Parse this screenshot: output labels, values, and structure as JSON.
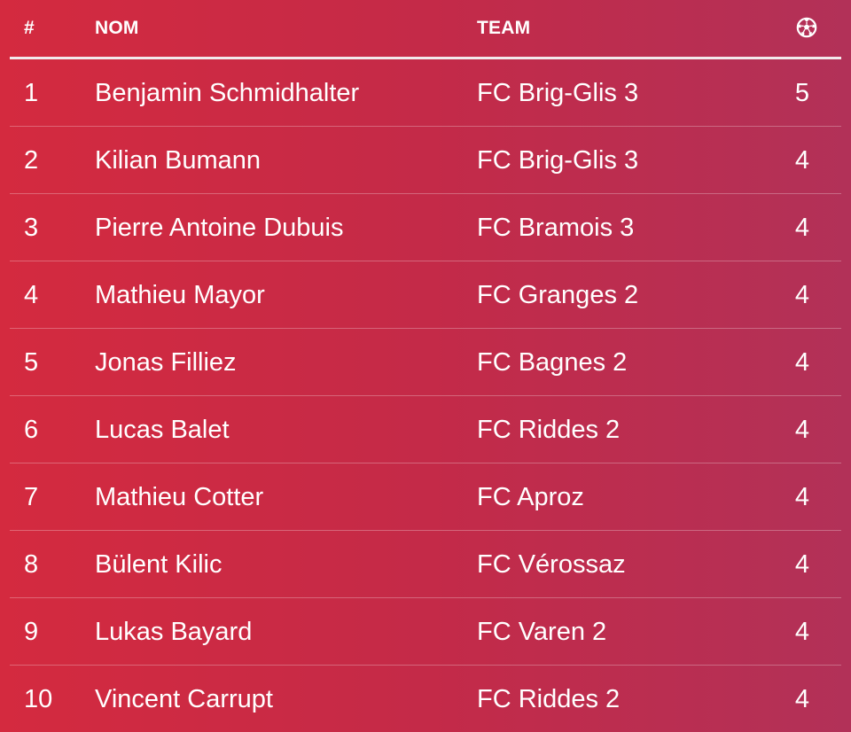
{
  "header": {
    "rank": "#",
    "name": "NOM",
    "team": "TEAM",
    "goals_icon": "soccer-ball-icon"
  },
  "rows": [
    {
      "rank": "1",
      "name": "Benjamin Schmidhalter",
      "team": "FC Brig-Glis 3",
      "goals": "5"
    },
    {
      "rank": "2",
      "name": "Kilian Bumann",
      "team": "FC Brig-Glis 3",
      "goals": "4"
    },
    {
      "rank": "3",
      "name": "Pierre Antoine Dubuis",
      "team": "FC Bramois 3",
      "goals": "4"
    },
    {
      "rank": "4",
      "name": "Mathieu Mayor",
      "team": "FC Granges 2",
      "goals": "4"
    },
    {
      "rank": "5",
      "name": "Jonas Filliez",
      "team": "FC Bagnes 2",
      "goals": "4"
    },
    {
      "rank": "6",
      "name": "Lucas Balet",
      "team": "FC Riddes 2",
      "goals": "4"
    },
    {
      "rank": "7",
      "name": "Mathieu Cotter",
      "team": "FC Aproz",
      "goals": "4"
    },
    {
      "rank": "8",
      "name": "Bülent Kilic",
      "team": "FC Vérossaz",
      "goals": "4"
    },
    {
      "rank": "9",
      "name": "Lukas Bayard",
      "team": "FC Varen 2",
      "goals": "4"
    },
    {
      "rank": "10",
      "name": "Vincent Carrupt",
      "team": "FC Riddes 2",
      "goals": "4"
    }
  ],
  "colors": {
    "background_start": "#d42a3f",
    "background_end": "#b23158",
    "text": "#ffffff"
  }
}
